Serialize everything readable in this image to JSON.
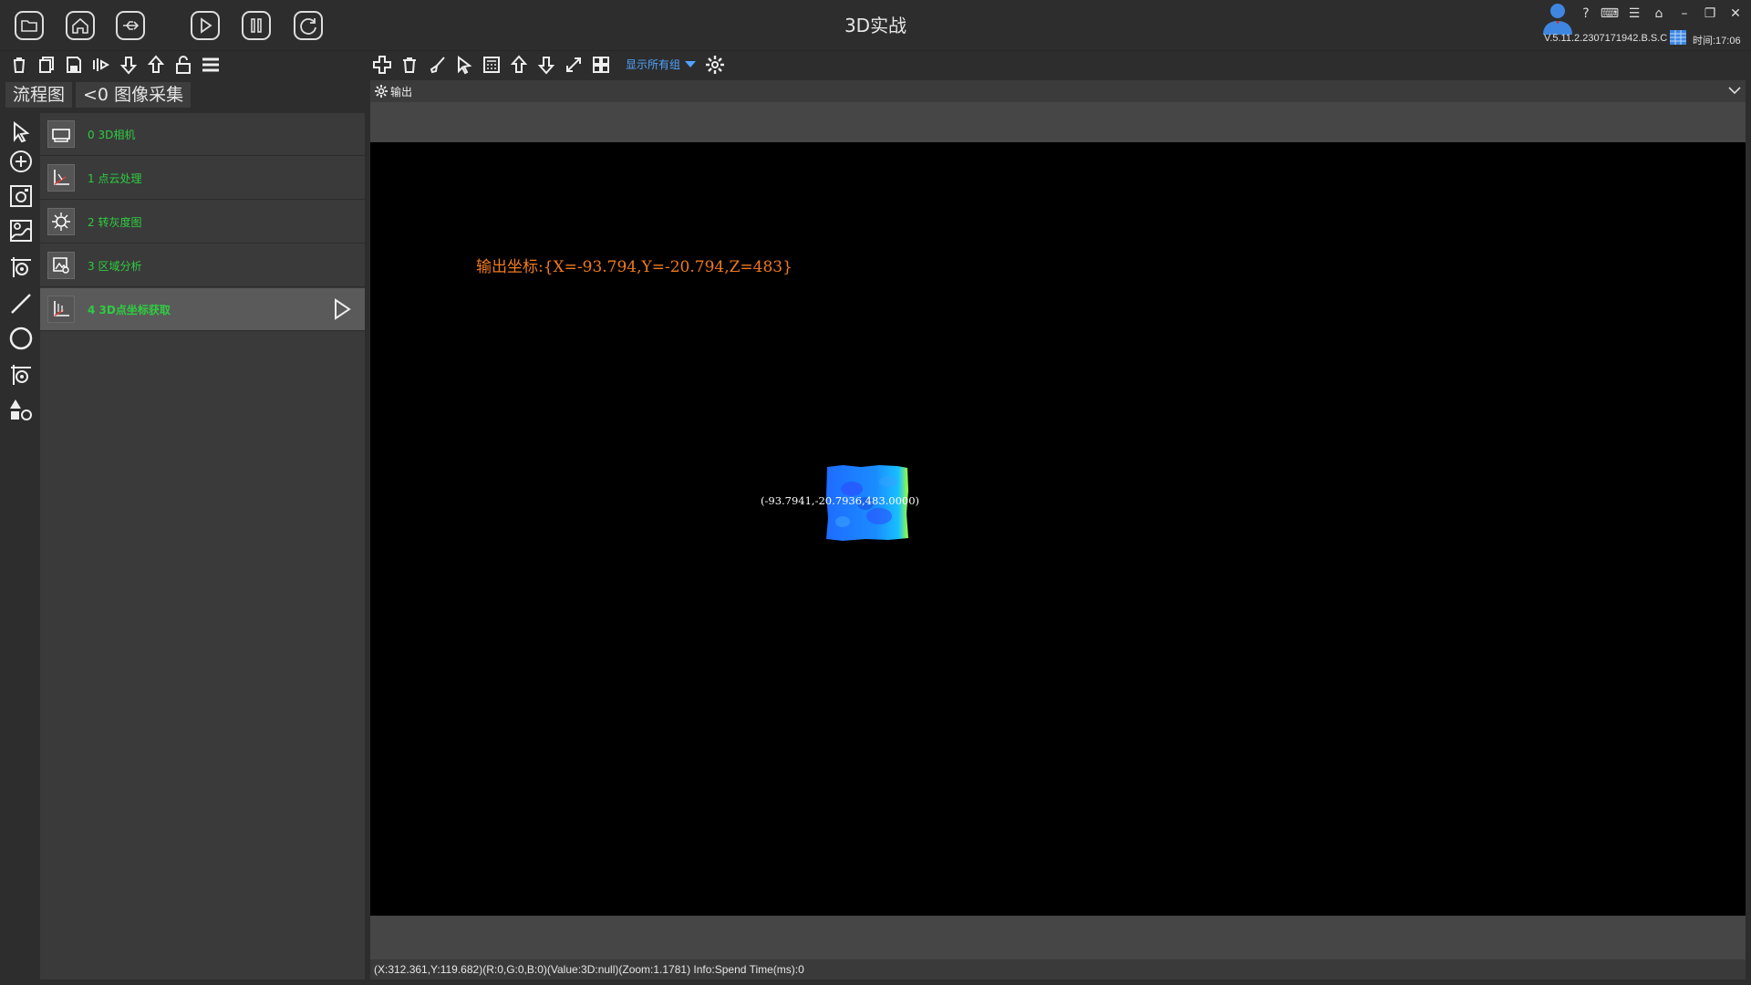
{
  "window": {
    "title": "3D实战",
    "version": "V.5.11.2.2307171942.B.S.C",
    "time_label": "时间:17:06",
    "controls": [
      "?",
      "⌨",
      "☰",
      "⌂",
      "–",
      "❐",
      "✕"
    ]
  },
  "titlebar_icons": [
    "folder-open-icon",
    "home-icon",
    "usb-icon",
    "play-icon",
    "pause-icon",
    "refresh-icon"
  ],
  "left_toolbar_icons": [
    "delete-icon",
    "copy-icon",
    "save-icon",
    "wave-icon",
    "arrow-down-icon",
    "arrow-up-icon",
    "unlock-icon",
    "menu-icon"
  ],
  "right_toolbar_icons": [
    "add-icon",
    "trash-icon",
    "brush-icon",
    "cursor-icon",
    "calc-icon",
    "arrow-up-icon",
    "arrow-down-icon",
    "expand-icon",
    "grid-icon"
  ],
  "toolbar": {
    "show_groups_label": "显示所有组"
  },
  "left_tabs": {
    "flow_tab": "流程图",
    "group_tab": "<0 图像采集"
  },
  "tool_column": [
    "pointer-icon",
    "add-circle-icon",
    "image-icon",
    "image-curve-icon",
    "target-icon",
    "line-icon",
    "circle-icon",
    "target2-icon",
    "shapes-icon"
  ],
  "flow_items": [
    {
      "label": "0  3D相机",
      "icon": "camera-3d-icon"
    },
    {
      "label": "1  点云处理",
      "icon": "point-cloud-icon"
    },
    {
      "label": "2  转灰度图",
      "icon": "grayscale-icon"
    },
    {
      "label": "3  区域分析",
      "icon": "region-icon"
    },
    {
      "label": "4 3D点坐标获取",
      "icon": "coordinate-icon",
      "active": true
    }
  ],
  "output": {
    "header_label": "输出",
    "coord_text": "输出坐标:{X=-93.794,Y=-20.794,Z=483}",
    "point_label": "(-93.7941,-20.7936,483.0000)"
  },
  "status": {
    "text": "(X:312.361,Y:119.682)(R:0,G:0,B:0)(Value:3D:null)(Zoom:1.1781)   Info:Spend Time(ms):0"
  },
  "colors": {
    "accent_blue": "#4fa3ff",
    "flow_green": "#2ecc40",
    "coord_orange": "#f07a1e"
  }
}
